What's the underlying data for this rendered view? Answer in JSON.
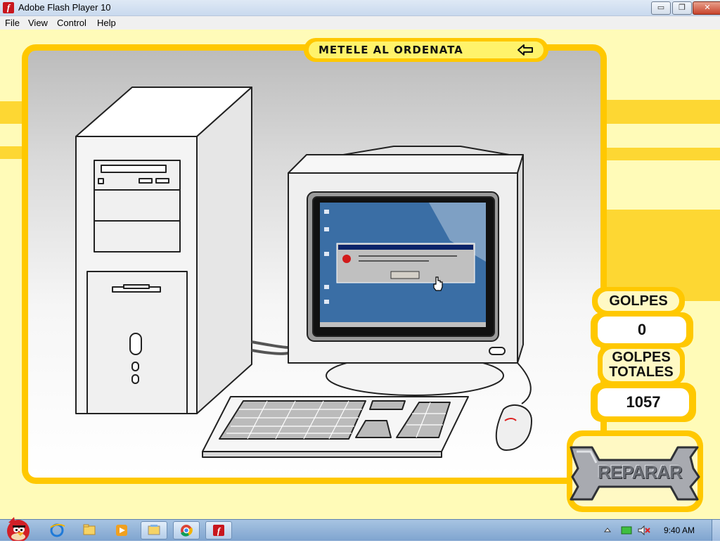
{
  "window": {
    "title": "Adobe Flash Player 10",
    "controls": {
      "minimize": "▭",
      "restore": "❐",
      "close": "✕"
    }
  },
  "menu": [
    "File",
    "View",
    "Control",
    "Help"
  ],
  "game": {
    "title": "METELE AL ORDENATA",
    "counters": {
      "hits_label": "GOLPES",
      "hits_value": "0",
      "total_label_line1": "GOLPES",
      "total_label_line2": "TOTALES",
      "total_value": "1057"
    },
    "repair_label": "REPARAR"
  },
  "taskbar": {
    "apps": [
      "angry-birds-start",
      "internet-explorer-icon",
      "folder-icon",
      "media-player-icon",
      "library-icon",
      "chrome-icon",
      "flash-player-icon"
    ],
    "clock": "9:40 AM"
  },
  "colors": {
    "frame": "#ffc800",
    "stage_background": "#fffbb8",
    "monitor_screen": "#3a6ea5"
  }
}
